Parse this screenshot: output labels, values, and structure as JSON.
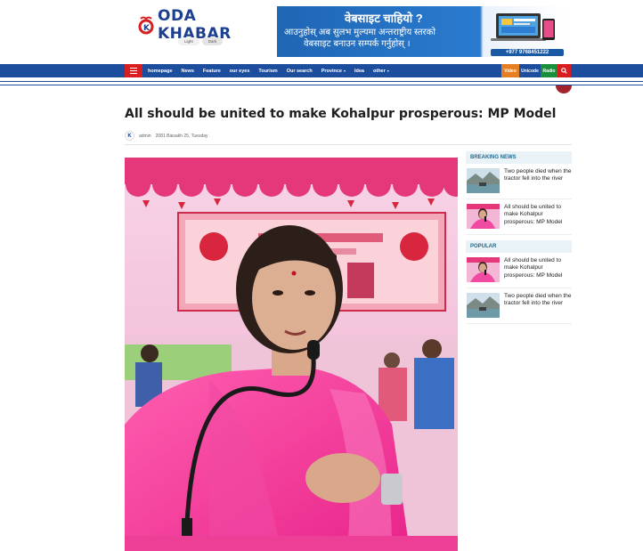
{
  "header": {
    "logo_text": "ODA KHABAR",
    "logo_mark": "K",
    "theme": {
      "light_label": "Light",
      "dark_label": "Dark"
    }
  },
  "ad": {
    "line1": "वेबसाइट चाहियो ?",
    "line2": "आउनुहोस् अब सुलभ मुल्यमा अन्तराष्ट्रीय स्तरको",
    "line3": "वेबसाइट बनाउन सम्पर्क गर्नुहोस् ।",
    "phone": "+977 9768451222"
  },
  "nav": {
    "items": [
      {
        "label": "homepage",
        "has_dropdown": false
      },
      {
        "label": "News",
        "has_dropdown": false
      },
      {
        "label": "Feature",
        "has_dropdown": false
      },
      {
        "label": "our eyes",
        "has_dropdown": false
      },
      {
        "label": "Tourism",
        "has_dropdown": false
      },
      {
        "label": "Our search",
        "has_dropdown": false
      },
      {
        "label": "Province",
        "has_dropdown": true
      },
      {
        "label": "Idea",
        "has_dropdown": false
      },
      {
        "label": "other",
        "has_dropdown": true
      }
    ],
    "video_label": "Video",
    "unicode_label": "Unicode",
    "radio_label": "Radio",
    "colors": {
      "nav_bg": "#1d4e9e",
      "accent_red": "#d81e1e",
      "video": "#e67e22",
      "radio": "#1a8f3c"
    }
  },
  "article": {
    "title": "All should be united to make Kohalpur prosperous: MP Model",
    "author": "admin",
    "date": "2081 Baisakh 25, Tuesday"
  },
  "sidebar": {
    "breaking_heading": "BREAKING NEWS",
    "breaking": [
      {
        "title": "Two people died when the tractor fell into the river",
        "thumb": "river"
      },
      {
        "title": "All should be united to make Kohalpur prosperous: MP Model",
        "thumb": "speaker"
      }
    ],
    "popular_heading": "POPULAR",
    "popular": [
      {
        "title": "All should be united to make Kohalpur prosperous: MP Model",
        "thumb": "speaker"
      },
      {
        "title": "Two people died when the tractor fell into the river",
        "thumb": "river"
      }
    ]
  }
}
